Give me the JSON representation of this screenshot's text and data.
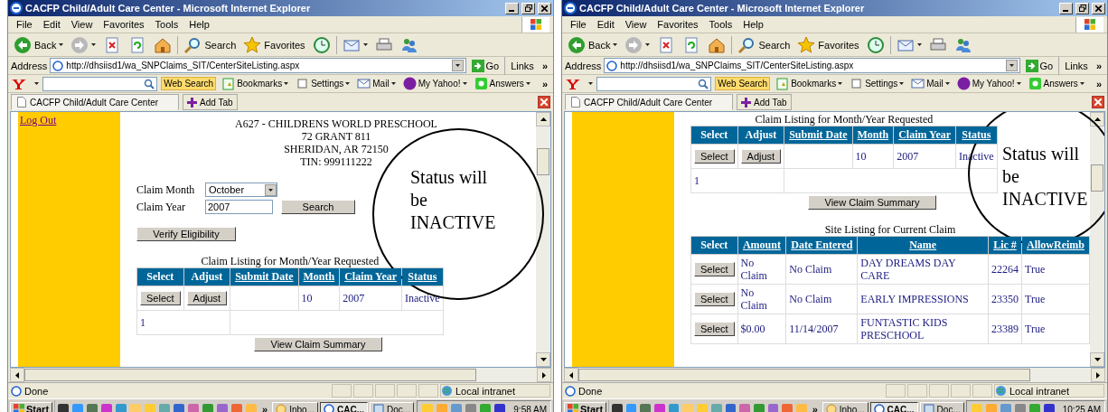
{
  "windows": [
    {
      "title": "CACFP Child/Adult Care Center - Microsoft Internet Explorer",
      "menu": [
        "File",
        "Edit",
        "View",
        "Favorites",
        "Tools",
        "Help"
      ],
      "toolbar": [
        {
          "kind": "back",
          "label": "Back"
        },
        {
          "kind": "forward"
        },
        {
          "kind": "stop"
        },
        {
          "kind": "refresh"
        },
        {
          "kind": "home"
        },
        {
          "kind": "search",
          "label": "Search"
        },
        {
          "kind": "favorites",
          "label": "Favorites"
        },
        {
          "kind": "history"
        },
        {
          "kind": "mail"
        },
        {
          "kind": "print"
        },
        {
          "kind": "messenger"
        }
      ],
      "address": {
        "label": "Address",
        "url": "http://dhsiisd1/wa_SNPClaims_SIT/CenterSiteListing.aspx",
        "go": "Go",
        "links": "Links",
        "more": "»"
      },
      "yahoo_bar": {
        "search_button": "Web Search",
        "more": "»",
        "items": [
          {
            "kind": "bookmarks",
            "label": "Bookmarks"
          },
          {
            "kind": "settings",
            "label": "Settings"
          },
          {
            "kind": "mail",
            "label": "Mail"
          },
          {
            "kind": "myyahoo",
            "label": "My Yahoo!"
          },
          {
            "kind": "answers",
            "label": "Answers"
          }
        ]
      },
      "tabs": [
        {
          "label": "CACFP Child/Adult Care Center",
          "selected": true
        }
      ],
      "add_tab": "Add Tab",
      "sidebar_links": [
        "Log Out"
      ],
      "page": [
        {
          "kind": "address",
          "lines": [
            "A627 - CHILDRENS WORLD PRESCHOOL",
            "72 GRANT 811",
            "SHERIDAN, AR 72150",
            "TIN: 999111222"
          ]
        },
        {
          "kind": "form",
          "fields": [
            {
              "kind": "select",
              "label": "Claim Month",
              "value": "October"
            },
            {
              "kind": "text",
              "label": "Claim Year",
              "value": "2007",
              "button": "Search"
            }
          ]
        },
        {
          "kind": "left_button",
          "label": "Verify Eligibility"
        },
        {
          "kind": "table",
          "caption": "Claim Listing for Month/Year Requested",
          "columns": [
            {
              "label": "Select",
              "sortable": false
            },
            {
              "label": "Adjust",
              "sortable": false
            },
            {
              "label": "Submit Date",
              "sortable": true
            },
            {
              "label": "Month",
              "sortable": true
            },
            {
              "label": "Claim Year",
              "sortable": true
            },
            {
              "label": "Status",
              "sortable": true
            }
          ],
          "rows": [
            [
              {
                "kind": "button",
                "text": "Select"
              },
              {
                "kind": "button",
                "text": "Adjust"
              },
              {
                "kind": "text",
                "text": ""
              },
              {
                "kind": "text",
                "text": "10"
              },
              {
                "kind": "text",
                "text": "2007"
              },
              {
                "kind": "text",
                "text": "Inactive"
              }
            ]
          ],
          "pager": "1"
        },
        {
          "kind": "center_button",
          "label": "View Claim Summary"
        }
      ],
      "callout": "Status will be INACTIVE",
      "status_bar": {
        "text": "Done",
        "zone": "Local intranet"
      },
      "taskbar": {
        "start": "Start",
        "more": "»",
        "tasks": [
          {
            "kind": "outlook",
            "label": "Inbo...",
            "selected": false
          },
          {
            "kind": "browser",
            "label": "CAC...",
            "selected": true
          },
          {
            "kind": "document",
            "label": "Doc...",
            "selected": false
          }
        ],
        "clock": "9:58 AM"
      }
    },
    {
      "title": "CACFP Child/Adult Care Center - Microsoft Internet Explorer",
      "menu": [
        "File",
        "Edit",
        "View",
        "Favorites",
        "Tools",
        "Help"
      ],
      "toolbar": [
        {
          "kind": "back",
          "label": "Back"
        },
        {
          "kind": "forward"
        },
        {
          "kind": "stop"
        },
        {
          "kind": "refresh"
        },
        {
          "kind": "home"
        },
        {
          "kind": "search",
          "label": "Search"
        },
        {
          "kind": "favorites",
          "label": "Favorites"
        },
        {
          "kind": "history"
        },
        {
          "kind": "mail"
        },
        {
          "kind": "print"
        },
        {
          "kind": "messenger"
        }
      ],
      "address": {
        "label": "Address",
        "url": "http://dhsiisd1/wa_SNPClaims_SIT/CenterSiteListing.aspx",
        "go": "Go",
        "links": "Links",
        "more": "»"
      },
      "yahoo_bar": {
        "search_button": "Web Search",
        "more": "»",
        "items": [
          {
            "kind": "bookmarks",
            "label": "Bookmarks"
          },
          {
            "kind": "settings",
            "label": "Settings"
          },
          {
            "kind": "mail",
            "label": "Mail"
          },
          {
            "kind": "myyahoo",
            "label": "My Yahoo!"
          },
          {
            "kind": "answers",
            "label": "Answers"
          }
        ]
      },
      "tabs": [
        {
          "label": "CACFP Child/Adult Care Center",
          "selected": true
        }
      ],
      "add_tab": "Add Tab",
      "page": [
        {
          "kind": "table",
          "caption": "Claim Listing for Month/Year Requested",
          "columns": [
            {
              "label": "Select",
              "sortable": false
            },
            {
              "label": "Adjust",
              "sortable": false
            },
            {
              "label": "Submit Date",
              "sortable": true
            },
            {
              "label": "Month",
              "sortable": true
            },
            {
              "label": "Claim Year",
              "sortable": true
            },
            {
              "label": "Status",
              "sortable": true
            }
          ],
          "rows": [
            [
              {
                "kind": "button",
                "text": "Select"
              },
              {
                "kind": "button",
                "text": "Adjust"
              },
              {
                "kind": "text",
                "text": ""
              },
              {
                "kind": "text",
                "text": "10"
              },
              {
                "kind": "text",
                "text": "2007"
              },
              {
                "kind": "text",
                "text": "Inactive"
              }
            ]
          ],
          "pager": "1"
        },
        {
          "kind": "center_button",
          "label": "View Claim Summary"
        },
        {
          "kind": "table",
          "caption": "Site Listing for Current Claim",
          "columns": [
            {
              "label": "Select",
              "sortable": false
            },
            {
              "label": "Amount",
              "sortable": true
            },
            {
              "label": "Date Entered",
              "sortable": true
            },
            {
              "label": "Name",
              "sortable": true
            },
            {
              "label": "Lic #",
              "sortable": true
            },
            {
              "label": "AllowReimb",
              "sortable": true
            }
          ],
          "rows": [
            [
              {
                "kind": "button",
                "text": "Select"
              },
              {
                "kind": "text",
                "text": "No Claim"
              },
              {
                "kind": "text",
                "text": "No Claim"
              },
              {
                "kind": "text",
                "text": "DAY DREAMS DAY CARE"
              },
              {
                "kind": "text",
                "text": "22264"
              },
              {
                "kind": "text",
                "text": "True"
              }
            ],
            [
              {
                "kind": "button",
                "text": "Select"
              },
              {
                "kind": "text",
                "text": "No Claim"
              },
              {
                "kind": "text",
                "text": "No Claim"
              },
              {
                "kind": "text",
                "text": "EARLY IMPRESSIONS"
              },
              {
                "kind": "text",
                "text": "23350"
              },
              {
                "kind": "text",
                "text": "True"
              }
            ],
            [
              {
                "kind": "button",
                "text": "Select"
              },
              {
                "kind": "text",
                "text": "$0.00"
              },
              {
                "kind": "text",
                "text": "11/14/2007"
              },
              {
                "kind": "text",
                "text": "FUNTASTIC KIDS PRESCHOOL"
              },
              {
                "kind": "text",
                "text": "23389"
              },
              {
                "kind": "text",
                "text": "True"
              }
            ]
          ]
        }
      ],
      "callout": "Status will be INACTIVE",
      "status_bar": {
        "text": "Done",
        "zone": "Local intranet"
      },
      "taskbar": {
        "start": "Start",
        "more": "»",
        "tasks": [
          {
            "kind": "outlook",
            "label": "Inbo...",
            "selected": false
          },
          {
            "kind": "browser",
            "label": "CAC...",
            "selected": true
          },
          {
            "kind": "document",
            "label": "Doc...",
            "selected": false
          }
        ],
        "clock": "10:25 AM"
      }
    }
  ]
}
